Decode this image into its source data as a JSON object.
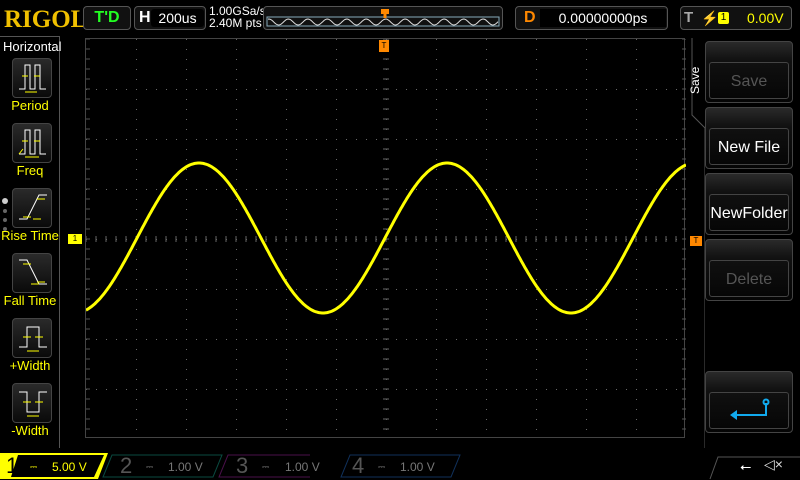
{
  "brand": "RIGOL",
  "trigger_status": "T'D",
  "horizontal": {
    "key": "H",
    "timebase": "200us"
  },
  "acquisition": {
    "sample_rate": "1.00GSa/s",
    "memory_depth": "2.40M pts"
  },
  "delay": {
    "key": "D",
    "value": "0.00000000ps"
  },
  "trigger": {
    "key": "T",
    "slope_icon": "rising-edge",
    "source": "1",
    "level": "0.00V"
  },
  "left_menu": {
    "title": "Horizontal",
    "items": [
      {
        "label": "Period"
      },
      {
        "label": "Freq"
      },
      {
        "label": "Rise Time"
      },
      {
        "label": "Fall Time"
      },
      {
        "label": "+Width"
      },
      {
        "label": "-Width"
      }
    ]
  },
  "right_menu": {
    "title": "Save",
    "items": [
      {
        "label": "Save",
        "enabled": false
      },
      {
        "label": "New File",
        "enabled": true
      },
      {
        "label": "NewFolder",
        "enabled": true
      },
      {
        "label": "Delete",
        "enabled": false
      }
    ],
    "back_icon": "return-arrow"
  },
  "markers": {
    "channel1": "1",
    "trigger": "T"
  },
  "channels": [
    {
      "num": "1",
      "scale": "5.00 V",
      "color": "#ffff00",
      "active": true
    },
    {
      "num": "2",
      "scale": "1.00 V",
      "color": "#00c0a0",
      "active": false
    },
    {
      "num": "3",
      "scale": "1.00 V",
      "color": "#c000c0",
      "active": false
    },
    {
      "num": "4",
      "scale": "1.00 V",
      "color": "#2080ff",
      "active": false
    }
  ],
  "status_icons": [
    "usb-icon",
    "mute-icon"
  ]
}
